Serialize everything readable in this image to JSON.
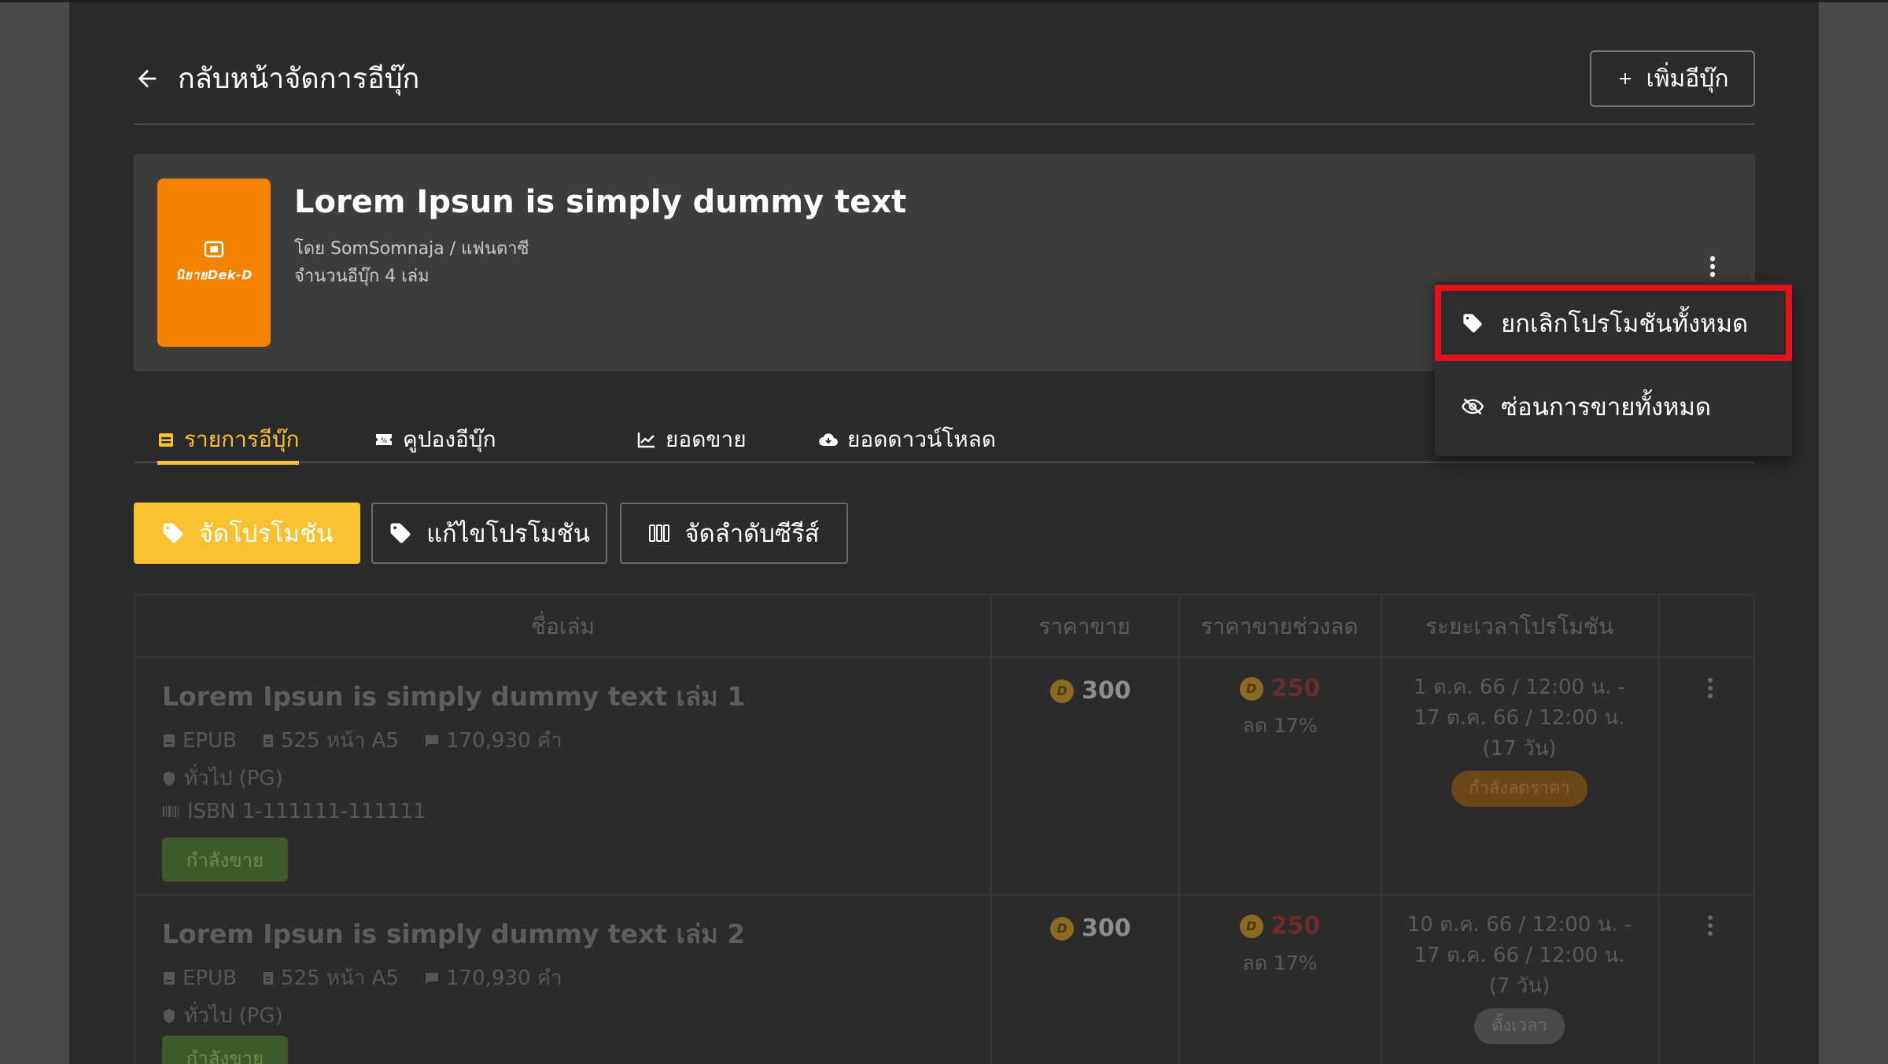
{
  "header": {
    "back_label": "กลับหน้าจัดการอีบุ๊ก",
    "add_label": "เพิ่มอีบุ๊ก"
  },
  "book": {
    "cover_text": "นิยายDek-D",
    "title": "Lorem Ipsun is simply dummy text",
    "byline": "โดย SomSomnaja / แฟนตาซี",
    "count": "จำนวนอีบุ๊ก 4 เล่ม"
  },
  "tabs": [
    {
      "label": "รายการอีบุ๊ก",
      "icon": "book-stack-icon",
      "active": true
    },
    {
      "label": "คูปองอีบุ๊ก",
      "icon": "coupon-icon",
      "active": false
    },
    {
      "label": "ยอดขาย",
      "icon": "sales-chart-icon",
      "active": false
    },
    {
      "label": "ยอดดาวน์โหลด",
      "icon": "cloud-download-icon",
      "active": false
    }
  ],
  "actions": {
    "create_promo": "จัดโปรโมชัน",
    "edit_promo": "แก้ไขโปรโมชัน",
    "sort_series": "จัดลำดับซีรีส์"
  },
  "dropdown": {
    "cancel_all_promos": "ยกเลิกโปรโมชันทั้งหมด",
    "hide_all_sales": "ซ่อนการขายทั้งหมด"
  },
  "table": {
    "headers": [
      "ชื่อเล่ม",
      "ราคาขาย",
      "ราคาขายช่วงลด",
      "ระยะเวลาโปรโมชัน"
    ],
    "rows": [
      {
        "title": "Lorem Ipsun is simply dummy text เล่ม 1",
        "format": "EPUB",
        "pages": "525 หน้า A5",
        "words": "170,930 คำ",
        "rating": "ทั่วไป (PG)",
        "isbn": "ISBN 1-111111-111111",
        "status": "กำลังขาย",
        "price": "300",
        "sale_price": "250",
        "discount": "ลด 17%",
        "period_line1": "1 ต.ค. 66 / 12:00 น. -",
        "period_line2": "17 ต.ค. 66 / 12:00 น.",
        "period_line3": "(17 วัน)",
        "promo_status": "กำลังลดราคา"
      },
      {
        "title": "Lorem Ipsun is simply dummy text เล่ม 2",
        "format": "EPUB",
        "pages": "525 หน้า A5",
        "words": "170,930 คำ",
        "rating": "ทั่วไป (PG)",
        "status": "กำลังขาย",
        "price": "300",
        "sale_price": "250",
        "discount": "ลด 17%",
        "period_line1": "10 ต.ค. 66 / 12:00 น. -",
        "period_line2": "17 ต.ค. 66 / 12:00 น.",
        "period_line3": "(7 วัน)",
        "promo_status": "ตั้งเวลา"
      }
    ]
  },
  "colors": {
    "accent": "#f9c12f",
    "cover": "#f28200",
    "highlight": "#e8101a"
  }
}
